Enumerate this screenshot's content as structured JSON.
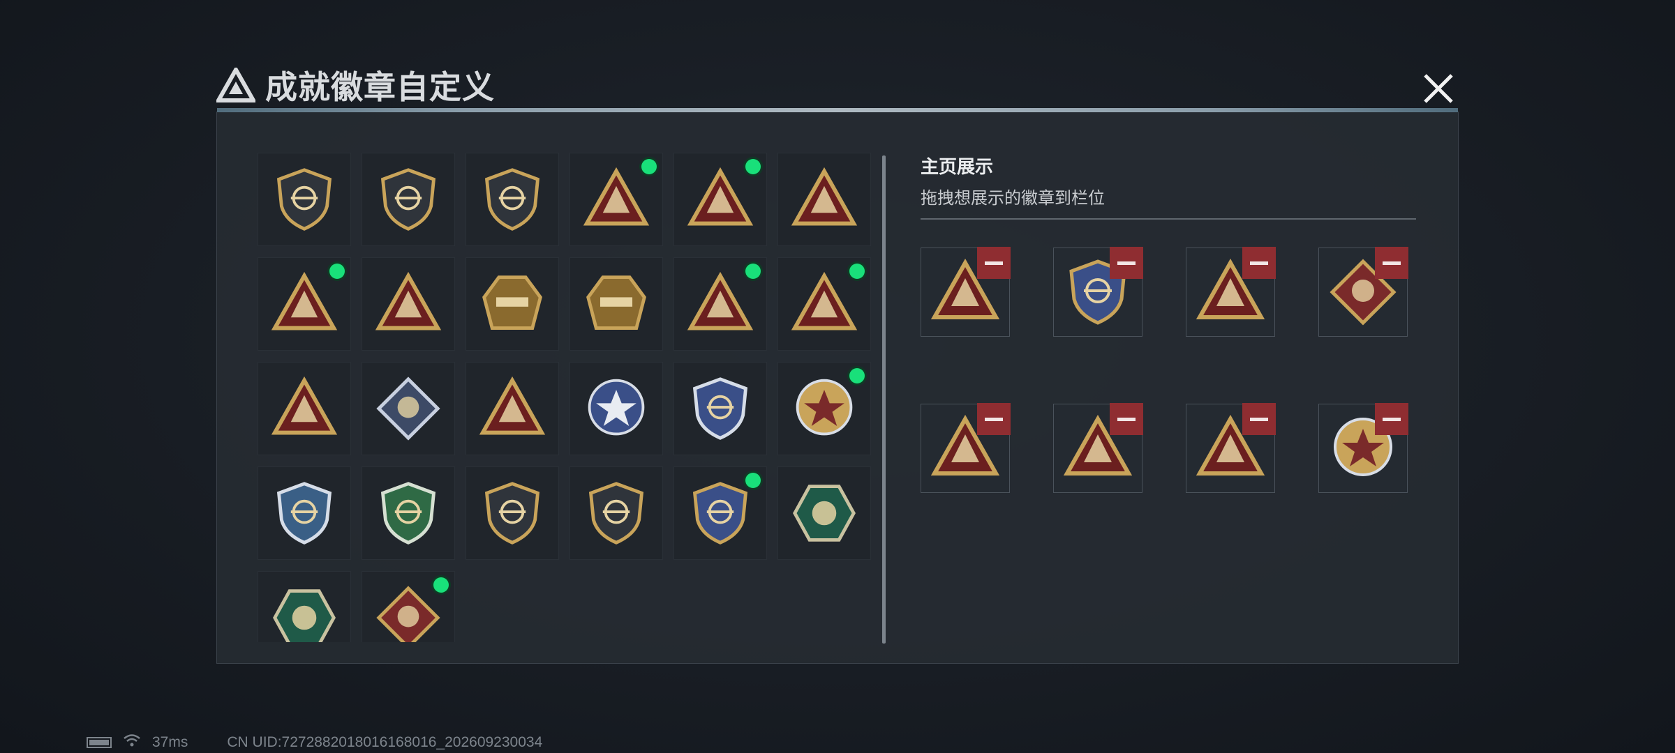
{
  "header": {
    "title": "成就徽章自定义",
    "logo_icon": "delta-triangle-icon",
    "close_icon": "close-icon"
  },
  "collection": {
    "badges": [
      {
        "icon": "delta-shield-badge-icon",
        "equipped": false
      },
      {
        "icon": "helicopter-shield-badge-icon",
        "equipped": false
      },
      {
        "icon": "blade-shield-badge-icon",
        "equipped": false
      },
      {
        "icon": "helicopter-triangle-badge-icon",
        "equipped": true
      },
      {
        "icon": "eri-globe-triangle-badge-icon",
        "equipped": true
      },
      {
        "icon": "hands-triangle-badge-icon",
        "equipped": false
      },
      {
        "icon": "number-1-triangle-badge-icon",
        "equipped": true
      },
      {
        "icon": "number-2-triangle-badge-icon",
        "equipped": false
      },
      {
        "icon": "delta-force-gator-badge-icon",
        "equipped": false
      },
      {
        "icon": "delta-force-2026-badge-icon",
        "equipped": false
      },
      {
        "icon": "usb-drive-triangle-badge-icon",
        "equipped": true
      },
      {
        "icon": "hands-crystal-triangle-badge-icon",
        "equipped": true
      },
      {
        "icon": "soldiers-triangle-badge-icon",
        "equipped": false
      },
      {
        "icon": "rose-diamond-badge-icon",
        "equipped": false
      },
      {
        "icon": "rifle-triangle-badge-icon",
        "equipped": false
      },
      {
        "icon": "star-round-badge-icon",
        "equipped": false
      },
      {
        "icon": "police-shield-badge-icon",
        "equipped": false
      },
      {
        "icon": "target-crest-badge-icon",
        "equipped": true
      },
      {
        "icon": "blue-crosshair-shield-badge-icon",
        "equipped": false
      },
      {
        "icon": "green-crosshair-shield-badge-icon",
        "equipped": false
      },
      {
        "icon": "bronze-rifle-shield-badge-icon",
        "equipped": false
      },
      {
        "icon": "bronze-crosshair-shield-badge-icon",
        "equipped": false
      },
      {
        "icon": "gold-crosshair-shield-badge-icon",
        "equipped": true
      },
      {
        "icon": "hornet-hexagon-badge-icon",
        "equipped": false
      },
      {
        "icon": "strongman-hexagon-badge-icon",
        "equipped": false
      },
      {
        "icon": "dragon-diamond-badge-icon",
        "equipped": true
      }
    ],
    "status_dot_color": "#19e07a"
  },
  "showcase": {
    "heading": "主页展示",
    "subtitle": "拖拽想展示的徽章到栏位",
    "slots": [
      {
        "icon": "helicopter-triangle-badge-icon"
      },
      {
        "icon": "gold-crosshair-shield-badge-icon"
      },
      {
        "icon": "hands-crystal-triangle-badge-icon"
      },
      {
        "icon": "dragon-diamond-badge-icon"
      },
      {
        "icon": "eri-globe-triangle-badge-icon"
      },
      {
        "icon": "usb-drive-triangle-badge-icon"
      },
      {
        "icon": "number-1-triangle-badge-icon"
      },
      {
        "icon": "target-crest-badge-icon"
      }
    ],
    "remove_icon": "minus-icon",
    "remove_color": "#8f2d31"
  },
  "status_bar": {
    "ping": "37ms",
    "uid": "CN UID:7272882018016168016_202609230034"
  }
}
